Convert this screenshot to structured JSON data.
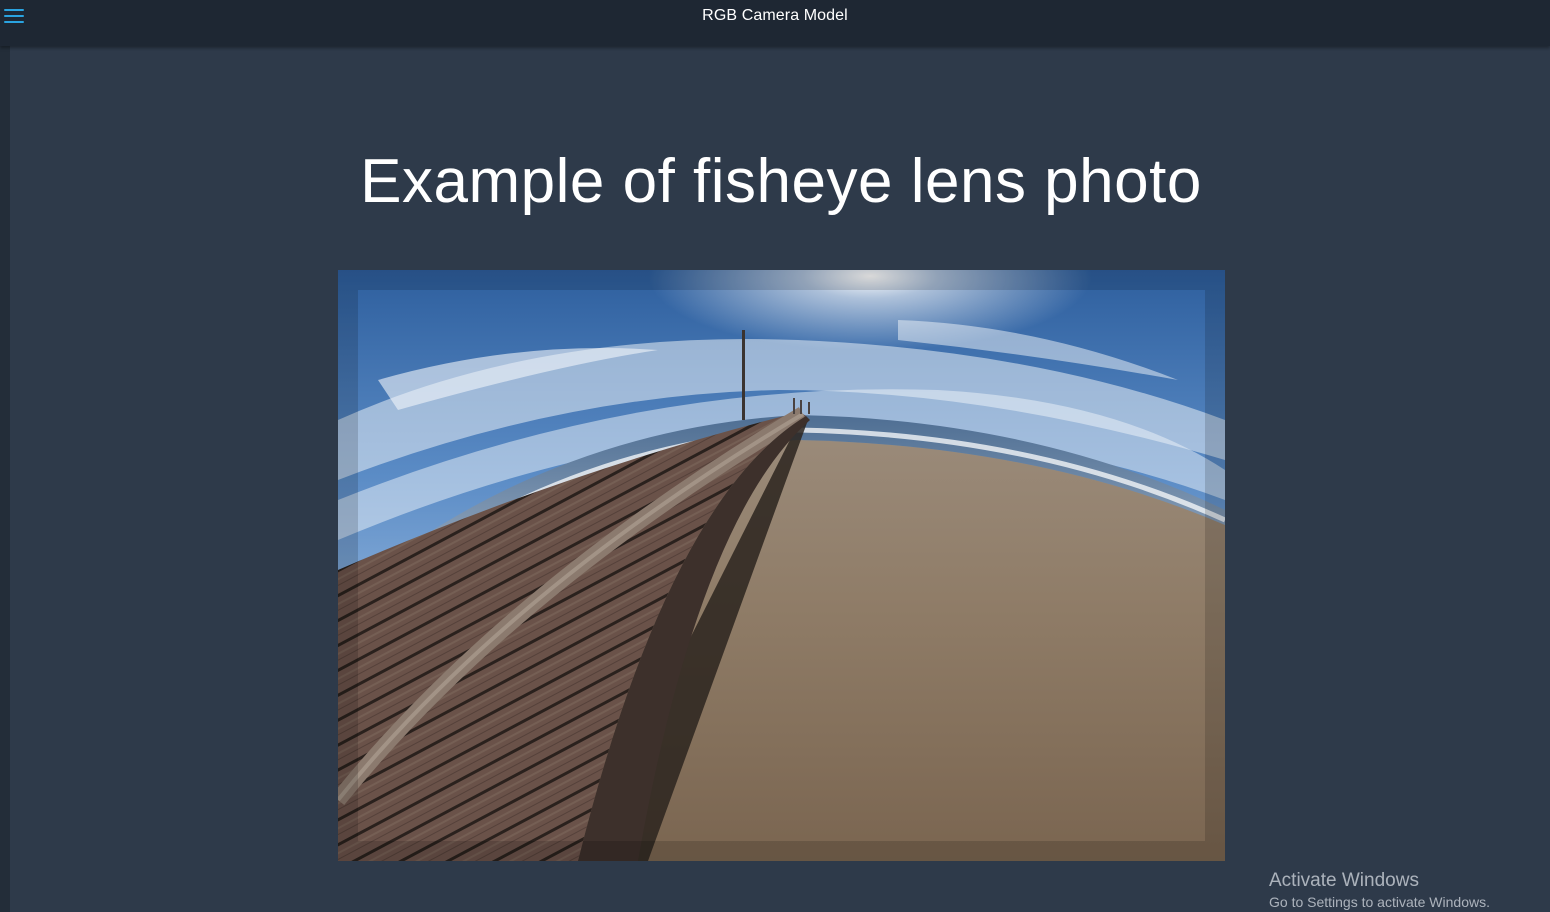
{
  "header": {
    "title": "RGB Camera Model",
    "menu_icon": "hamburger-menu-icon",
    "accent_color": "#2aa3e0"
  },
  "slide": {
    "heading": "Example of fisheye lens photo",
    "image": {
      "alt": "fisheye lens photo",
      "subject": "wooden pier on sandy beach"
    }
  },
  "watermark": {
    "title": "Activate Windows",
    "subtitle": "Go to Settings to activate Windows."
  },
  "colors": {
    "background": "#2e3a4a",
    "topbar": "#1e2733"
  }
}
